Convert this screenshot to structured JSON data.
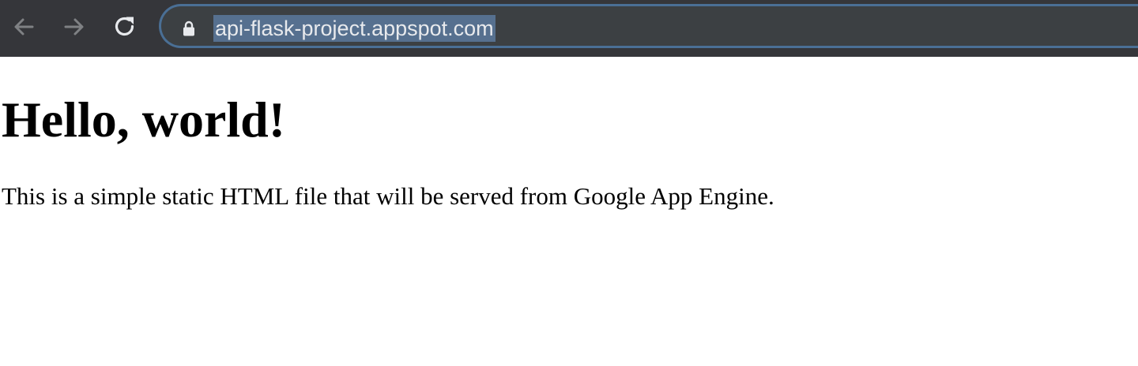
{
  "browser": {
    "address_bar": {
      "url": "api-flask-project.appspot.com"
    },
    "icons": {
      "back": "arrow-left-icon",
      "forward": "arrow-right-icon",
      "reload": "reload-icon",
      "secure": "lock-icon"
    }
  },
  "page": {
    "heading": "Hello, world!",
    "paragraph": "This is a simple static HTML file that will be served from Google App Engine."
  },
  "colors": {
    "toolbar_bg": "#35363a",
    "omnibox_bg": "#3c4043",
    "omnibox_focus_border": "#4a6f95",
    "url_selection": "#56708f",
    "url_text": "#e8eaed",
    "page_bg": "#ffffff",
    "page_text": "#000000"
  }
}
